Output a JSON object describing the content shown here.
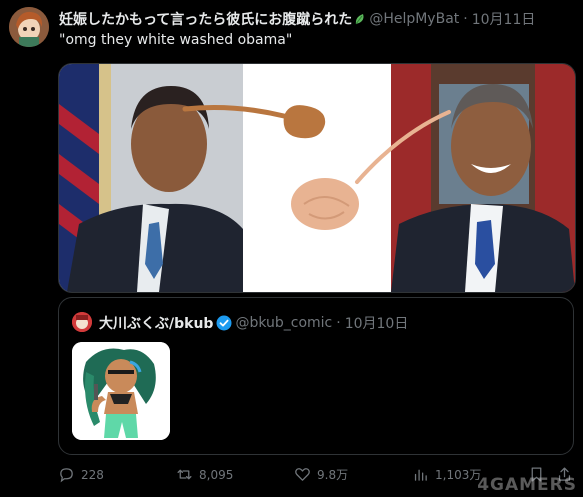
{
  "tweet": {
    "display_name": "妊娠したかもって言ったら彼氏にお腹蹴られた",
    "handle": "@HelpMyBat",
    "separator": "·",
    "date": "10月11日",
    "text": "\"omg they white washed obama\""
  },
  "quote": {
    "display_name": "大川ぶくぶ/bkub",
    "handle": "@bkub_comic",
    "separator": "·",
    "date": "10月10日"
  },
  "actions": {
    "replies": "228",
    "retweets": "8,095",
    "likes": "9.8万",
    "views": "1,103万"
  },
  "watermark": "4GAMERS",
  "colors": {
    "background": "#000000",
    "text": "#e7e9ea",
    "muted": "#71767b",
    "border": "#2f3336",
    "verified": "#1d9bf0",
    "brown_drawing": "#b9763f",
    "beige_drawing": "#e8b392"
  }
}
